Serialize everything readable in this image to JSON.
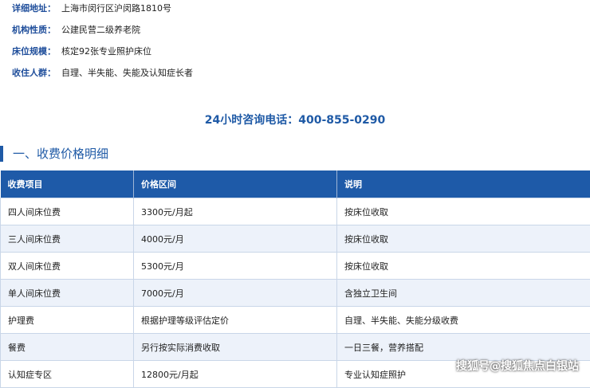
{
  "info": [
    {
      "key": "详细地址：",
      "value": "上海市闵行区沪闵路1810号"
    },
    {
      "key": "机构性质：",
      "value": "公建民营二级养老院"
    },
    {
      "key": "床位规模：",
      "value": "核定92张专业照护床位"
    },
    {
      "key": "收住人群：",
      "value": "自理、半失能、失能及认知症长者"
    }
  ],
  "hotline": "24小时咨询电话：400-855-0290",
  "section_title": "一、收费价格明细",
  "table": {
    "headers": [
      "收费项目",
      "价格区间",
      "说明"
    ],
    "rows": [
      [
        "四人间床位费",
        "3300元/月起",
        "按床位收取"
      ],
      [
        "三人间床位费",
        "4000元/月",
        "按床位收取"
      ],
      [
        "双人间床位费",
        "5300元/月",
        "按床位收取"
      ],
      [
        "单人间床位费",
        "7000元/月",
        "含独立卫生间"
      ],
      [
        "护理费",
        "根据护理等级评估定价",
        "自理、半失能、失能分级收费"
      ],
      [
        "餐费",
        "另行按实际消费收取",
        "一日三餐，营养搭配"
      ],
      [
        "认知症专区",
        "12800元/月起",
        "专业认知症照护"
      ]
    ]
  },
  "watermark": "搜狐号@搜狐焦点白银站"
}
